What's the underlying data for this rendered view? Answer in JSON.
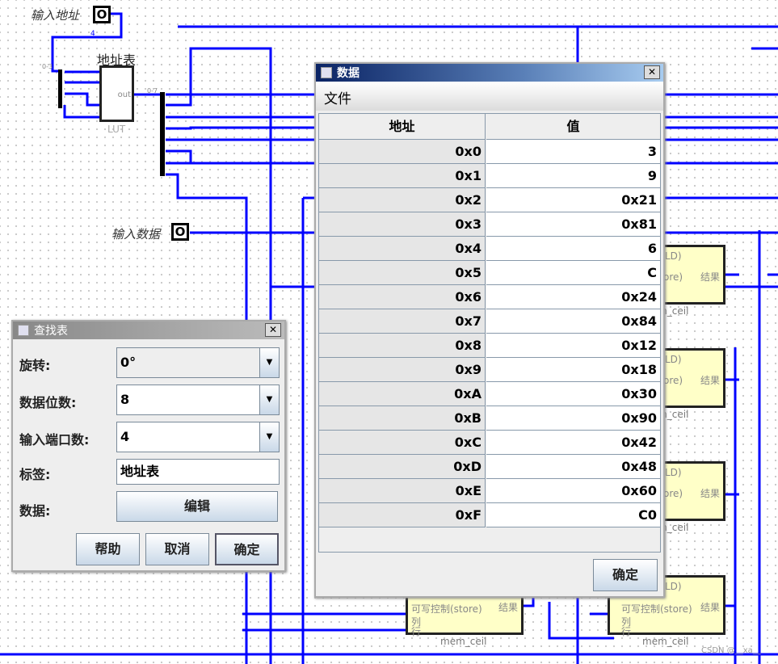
{
  "circuit": {
    "input_address_label": "输入地址",
    "input_data_label": "输入数据",
    "lut_label": "地址表",
    "lut_type": "LUT",
    "lut_out": "out",
    "pin_glyph": "O",
    "bus_width": "4",
    "split_in": "0-3",
    "split_out": "0-7",
    "cell_result": "结果",
    "cell_name": "mem_ceil",
    "cell_store": "可写控制(store)",
    "cell_col": "列",
    "cell_row": "行",
    "cell_ld": "LD)",
    "cell_ore": "ore)",
    "watermark": "CSDN @__xa__",
    "wire_color": "#0000ff"
  },
  "lookup_dialog": {
    "title": "查找表",
    "close": "✕",
    "fields": [
      {
        "label": "旋转:",
        "value": "0°"
      },
      {
        "label": "数据位数:",
        "value": "8"
      },
      {
        "label": "输入端口数:",
        "value": "4"
      },
      {
        "label": "标签:",
        "value": "地址表"
      },
      {
        "label": "数据:",
        "value": "编辑"
      }
    ],
    "buttons": {
      "help": "帮助",
      "cancel": "取消",
      "ok": "确定"
    }
  },
  "data_dialog": {
    "title": "数据",
    "close": "✕",
    "menu_file": "文件",
    "columns": [
      "地址",
      "值"
    ],
    "rows": [
      [
        "0x0",
        "3"
      ],
      [
        "0x1",
        "9"
      ],
      [
        "0x2",
        "0x21"
      ],
      [
        "0x3",
        "0x81"
      ],
      [
        "0x4",
        "6"
      ],
      [
        "0x5",
        "C"
      ],
      [
        "0x6",
        "0x24"
      ],
      [
        "0x7",
        "0x84"
      ],
      [
        "0x8",
        "0x12"
      ],
      [
        "0x9",
        "0x18"
      ],
      [
        "0xA",
        "0x30"
      ],
      [
        "0xB",
        "0x90"
      ],
      [
        "0xC",
        "0x42"
      ],
      [
        "0xD",
        "0x48"
      ],
      [
        "0xE",
        "0x60"
      ],
      [
        "0xF",
        "C0"
      ]
    ],
    "ok": "确定"
  }
}
